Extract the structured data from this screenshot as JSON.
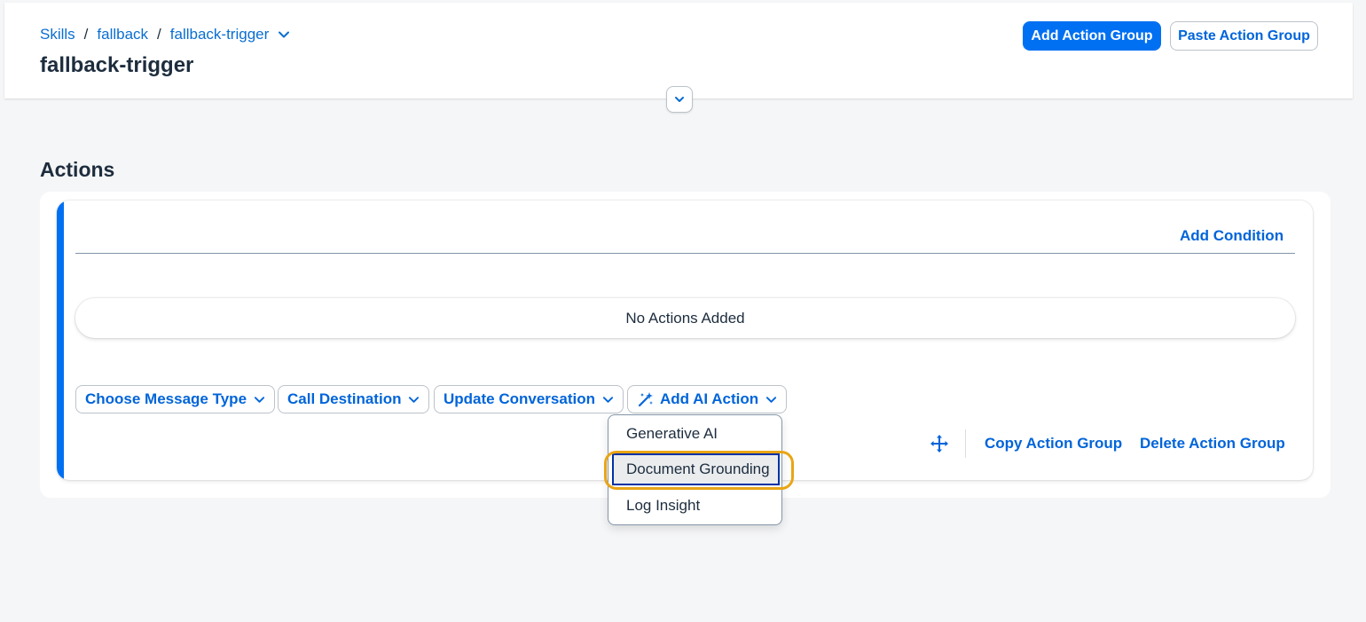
{
  "breadcrumb": {
    "items": [
      "Skills",
      "fallback",
      "fallback-trigger"
    ],
    "separator": "/"
  },
  "page": {
    "title": "fallback-trigger"
  },
  "toolbar": {
    "add_action_group_label": "Add Action Group",
    "paste_action_group_label": "Paste Action Group"
  },
  "actions": {
    "section_title": "Actions",
    "add_condition_label": "Add Condition",
    "empty_state": "No Actions Added",
    "menu_buttons": [
      "Choose Message Type",
      "Call Destination",
      "Update Conversation",
      "Add AI Action"
    ],
    "copy_group_label": "Copy Action Group",
    "delete_group_label": "Delete Action Group"
  },
  "ai_action_menu": {
    "items": [
      "Generative AI",
      "Document Grounding",
      "Log Insight"
    ],
    "focused_item": "Document Grounding"
  },
  "icons": {
    "breadcrumb_dropdown": "chevron-down-icon",
    "collapse_header": "chevron-down-icon",
    "ai_action": "magic-wand-icon",
    "move": "move-icon"
  },
  "colors": {
    "accent": "#0070f2",
    "link": "#0064d9",
    "focus_ring": "#e9a515"
  }
}
